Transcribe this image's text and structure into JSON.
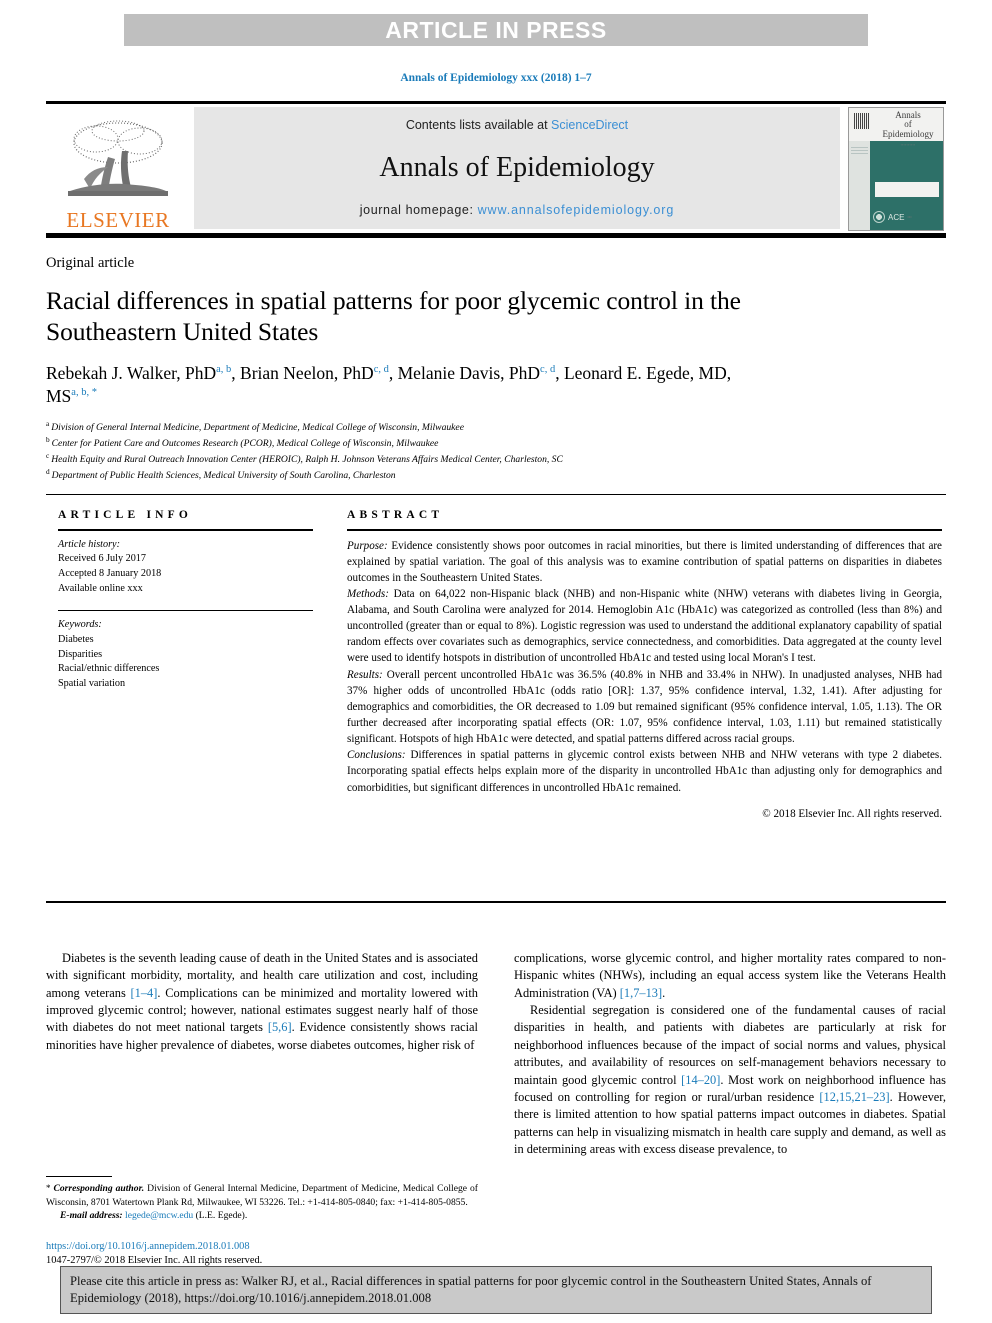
{
  "banner": {
    "press_label": "ARTICLE IN PRESS"
  },
  "running_head": "Annals of Epidemiology xxx (2018) 1–7",
  "masthead": {
    "contents_prefix": "Contents lists available at ",
    "sciencedirect": "ScienceDirect",
    "journal_name": "Annals of Epidemiology",
    "homepage_prefix": "journal homepage: ",
    "homepage_url": "www.annalsofepidemiology.org",
    "publisher": "ELSEVIER",
    "cover": {
      "title_line1": "Annals",
      "title_line2": "of",
      "title_line3": "Epidemiology",
      "title_sub": "••••••••••",
      "society": "ACE",
      "society_suffix": "•••"
    }
  },
  "article": {
    "kind": "Original article",
    "title": "Racial differences in spatial patterns for poor glycemic control in the Southeastern United States",
    "authors": [
      {
        "name": "Rebekah J. Walker, PhD",
        "marks": "a, b",
        "sep": ", "
      },
      {
        "name": "Brian Neelon, PhD",
        "marks": "c, d",
        "sep": ", "
      },
      {
        "name": "Melanie Davis, PhD",
        "marks": "c, d",
        "sep": ", "
      },
      {
        "name": "Leonard E. Egede, MD, MS",
        "marks": "a, b, *",
        "sep": ""
      }
    ],
    "affiliations": [
      {
        "mark": "a",
        "text": "Division of General Internal Medicine, Department of Medicine, Medical College of Wisconsin, Milwaukee"
      },
      {
        "mark": "b",
        "text": "Center for Patient Care and Outcomes Research (PCOR), Medical College of Wisconsin, Milwaukee"
      },
      {
        "mark": "c",
        "text": "Health Equity and Rural Outreach Innovation Center (HEROIC), Ralph H. Johnson Veterans Affairs Medical Center, Charleston, SC"
      },
      {
        "mark": "d",
        "text": "Department of Public Health Sciences, Medical University of South Carolina, Charleston"
      }
    ]
  },
  "article_info": {
    "heading": "ARTICLE INFO",
    "history_label": "Article history:",
    "history": [
      "Received 6 July 2017",
      "Accepted 8 January 2018",
      "Available online xxx"
    ],
    "keywords_label": "Keywords:",
    "keywords": [
      "Diabetes",
      "Disparities",
      "Racial/ethnic differences",
      "Spatial variation"
    ]
  },
  "abstract": {
    "heading": "ABSTRACT",
    "sections": [
      {
        "label": "Purpose:",
        "text": " Evidence consistently shows poor outcomes in racial minorities, but there is limited understanding of differences that are explained by spatial variation. The goal of this analysis was to examine contribution of spatial patterns on disparities in diabetes outcomes in the Southeastern United States."
      },
      {
        "label": "Methods:",
        "text": " Data on 64,022 non-Hispanic black (NHB) and non-Hispanic white (NHW) veterans with diabetes living in Georgia, Alabama, and South Carolina were analyzed for 2014. Hemoglobin A1c (HbA1c) was categorized as controlled (less than 8%) and uncontrolled (greater than or equal to 8%). Logistic regression was used to understand the additional explanatory capability of spatial random effects over covariates such as demographics, service connectedness, and comorbidities. Data aggregated at the county level were used to identify hotspots in distribution of uncontrolled HbA1c and tested using local Moran's I test."
      },
      {
        "label": "Results:",
        "text": " Overall percent uncontrolled HbA1c was 36.5% (40.8% in NHB and 33.4% in NHW). In unadjusted analyses, NHB had 37% higher odds of uncontrolled HbA1c (odds ratio [OR]: 1.37, 95% confidence interval, 1.32, 1.41). After adjusting for demographics and comorbidities, the OR decreased to 1.09 but remained significant (95% confidence interval, 1.05, 1.13). The OR further decreased after incorporating spatial effects (OR: 1.07, 95% confidence interval, 1.03, 1.11) but remained statistically significant. Hotspots of high HbA1c were detected, and spatial patterns differed across racial groups."
      },
      {
        "label": "Conclusions:",
        "text": " Differences in spatial patterns in glycemic control exists between NHB and NHW veterans with type 2 diabetes. Incorporating spatial effects helps explain more of the disparity in uncontrolled HbA1c than adjusting only for demographics and comorbidities, but significant differences in uncontrolled HbA1c remained."
      }
    ],
    "copyright": "© 2018 Elsevier Inc. All rights reserved."
  },
  "body": {
    "left_column": [
      {
        "runs": [
          {
            "t": "Diabetes is the seventh leading cause of death in the United States and is associated with significant morbidity, mortality, and health care utilization and cost, including among veterans "
          },
          {
            "t": "[1–4]",
            "k": "ref"
          },
          {
            "t": ". Complications can be minimized and mortality lowered with improved glycemic control; however, national estimates suggest nearly half of those with diabetes do not meet national targets "
          },
          {
            "t": "[5,6]",
            "k": "ref"
          },
          {
            "t": ". Evidence consistently shows racial minorities have higher prevalence of diabetes, worse diabetes outcomes, higher risk of"
          }
        ]
      }
    ],
    "right_column": [
      {
        "noindent": true,
        "runs": [
          {
            "t": "complications, worse glycemic control, and higher mortality rates compared to non-Hispanic whites (NHWs), including an equal access system like the Veterans Health Administration (VA) "
          },
          {
            "t": "[1,7–13]",
            "k": "ref"
          },
          {
            "t": "."
          }
        ]
      },
      {
        "runs": [
          {
            "t": "Residential segregation is considered one of the fundamental causes of racial disparities in health, and patients with diabetes are particularly at risk for neighborhood influences because of the impact of social norms and values, physical attributes, and availability of resources on self-management behaviors necessary to maintain good glycemic control "
          },
          {
            "t": "[14–20]",
            "k": "ref"
          },
          {
            "t": ". Most work on neighborhood influence has focused on controlling for region or rural/urban residence "
          },
          {
            "t": "[12,15,21–23]",
            "k": "ref"
          },
          {
            "t": ". However, there is limited attention to how spatial patterns impact outcomes in diabetes. Spatial patterns can help in visualizing mismatch in health care supply and demand, as well as in determining areas with excess disease prevalence, to"
          }
        ]
      }
    ]
  },
  "footnote": {
    "star": "*",
    "corresponding_label": " Corresponding author.",
    "corresponding_text": " Division of General Internal Medicine, Department of Medicine, Medical College of Wisconsin, 8701 Watertown Plank Rd, Milwaukee, WI 53226. Tel.: +1-414-805-0840; fax: +1-414-805-0855.",
    "email_label": "E-mail address:",
    "email": "legede@mcw.edu",
    "email_owner": " (L.E. Egede)."
  },
  "doi": {
    "link": "https://doi.org/10.1016/j.annepidem.2018.01.008",
    "issn_line": "1047-2797/© 2018 Elsevier Inc. All rights reserved."
  },
  "cite_box": {
    "text": "Please cite this article in press as: Walker RJ, et al., Racial differences in spatial patterns for poor glycemic control in the Southeastern United States, Annals of Epidemiology (2018), https://doi.org/10.1016/j.annepidem.2018.01.008"
  }
}
